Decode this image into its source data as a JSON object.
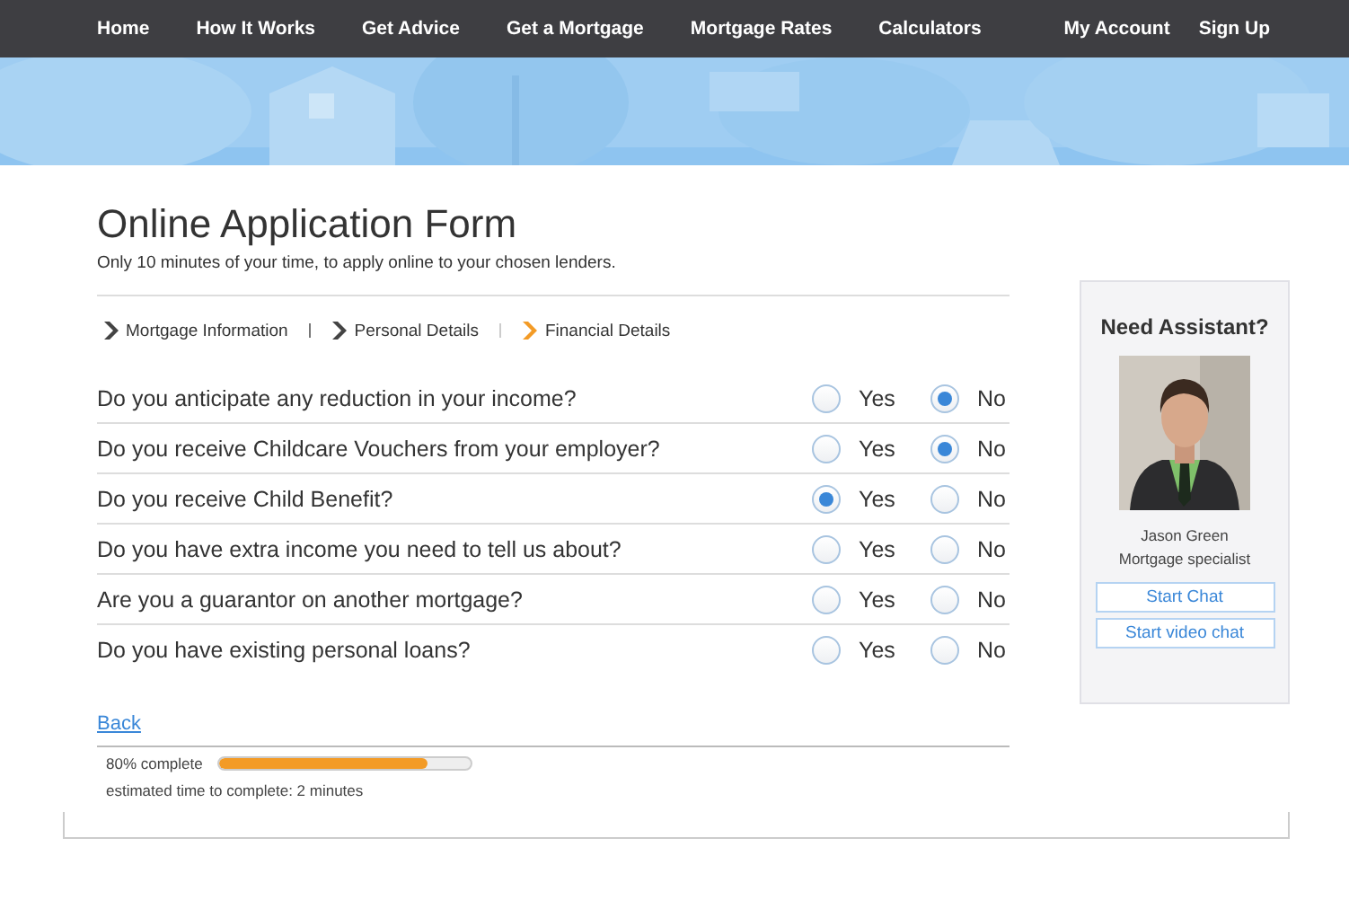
{
  "nav": {
    "left": [
      "Home",
      "How It Works",
      "Get Advice",
      "Get a Mortgage",
      "Mortgage Rates",
      "Calculators"
    ],
    "right": [
      "My Account",
      "Sign Up"
    ]
  },
  "banner": {
    "kind": "picture"
  },
  "form": {
    "title": "Online Application Form",
    "subtitle": "Only 10 minutes of your time, to apply online to your chosen lenders.",
    "steps": [
      {
        "label": "Mortgage Information",
        "selected": false
      },
      {
        "label": "Personal Details",
        "selected": false
      },
      {
        "label": "Financial Details",
        "selected": true
      }
    ],
    "questions": [
      {
        "text": "Do you anticipate any reduction in your income?",
        "options": [
          {
            "label": "Yes",
            "selected": false
          },
          {
            "label": "No",
            "selected": true
          }
        ]
      },
      {
        "text": "Do you receive Childcare Vouchers from your employer?",
        "options": [
          {
            "label": "Yes",
            "selected": false
          },
          {
            "label": "No",
            "selected": true
          }
        ]
      },
      {
        "text": "Do you receive Child Benefit?",
        "options": [
          {
            "label": "Yes",
            "selected": true
          },
          {
            "label": "No",
            "selected": false
          }
        ]
      },
      {
        "text": "Do you have extra income you need to tell us about?",
        "options": [
          {
            "label": "Yes",
            "selected": false
          },
          {
            "label": "No",
            "selected": false
          }
        ]
      },
      {
        "text": "Are you a guarantor on another mortgage?",
        "options": [
          {
            "label": "Yes",
            "selected": false
          },
          {
            "label": "No",
            "selected": false
          }
        ]
      },
      {
        "text": "Do you have existing personal loans?",
        "options": [
          {
            "label": "Yes",
            "selected": false
          },
          {
            "label": "No",
            "selected": false
          }
        ]
      }
    ],
    "back_link": "Back",
    "progress": {
      "label": "80% complete",
      "level": 0.83,
      "estimate": "estimated time to complete: 2 minutes"
    }
  },
  "assistant": {
    "title": "Need Assistant?",
    "photo": {
      "kind": "picture"
    },
    "name": "Jason Green",
    "role": "Mortgage specialist",
    "buttons": [
      "Start Chat",
      "Start video chat"
    ]
  }
}
